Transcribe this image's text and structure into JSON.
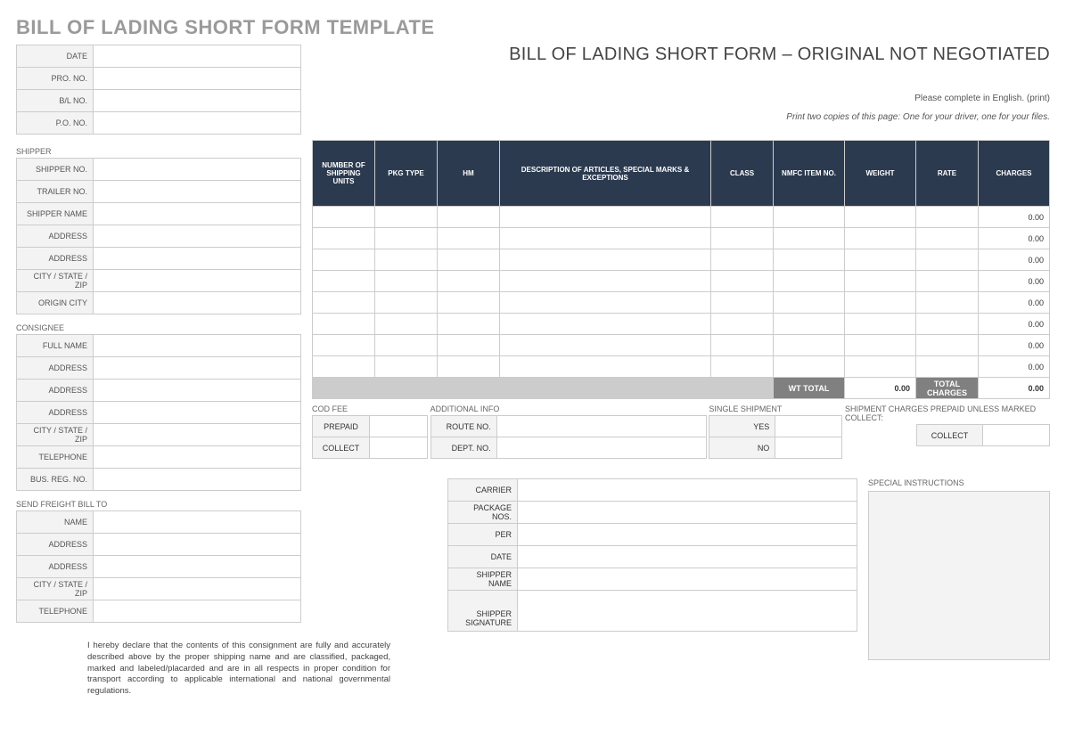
{
  "page_title": "BILL OF LADING SHORT FORM TEMPLATE",
  "form_title": "BILL OF LADING SHORT FORM – ORIGINAL NOT NEGOTIATED",
  "instructions_1": "Please complete in English. (print)",
  "instructions_2": "Print two copies of this page: One for your driver, one for your files.",
  "header_fields": {
    "date_label": "DATE",
    "date": "",
    "pro_no_label": "PRO. NO.",
    "pro_no": "",
    "bl_no_label": "B/L NO.",
    "bl_no": "",
    "po_no_label": "P.O. NO.",
    "po_no": ""
  },
  "shipper": {
    "section": "SHIPPER",
    "shipper_no_label": "SHIPPER NO.",
    "shipper_no": "",
    "trailer_no_label": "TRAILER NO.",
    "trailer_no": "",
    "name_label": "SHIPPER NAME",
    "name": "",
    "address1_label": "ADDRESS",
    "address1": "",
    "address2_label": "ADDRESS",
    "address2": "",
    "csz_label": "CITY / STATE / ZIP",
    "csz": "",
    "origin_label": "ORIGIN CITY",
    "origin": ""
  },
  "consignee": {
    "section": "CONSIGNEE",
    "name_label": "FULL NAME",
    "name": "",
    "address1_label": "ADDRESS",
    "address1": "",
    "address2_label": "ADDRESS",
    "address2": "",
    "address3_label": "ADDRESS",
    "address3": "",
    "csz_label": "CITY / STATE / ZIP",
    "csz": "",
    "phone_label": "TELEPHONE",
    "phone": "",
    "busreg_label": "BUS. REG. NO.",
    "busreg": ""
  },
  "freight_bill": {
    "section": "SEND FREIGHT BILL TO",
    "name_label": "NAME",
    "name": "",
    "address1_label": "ADDRESS",
    "address1": "",
    "address2_label": "ADDRESS",
    "address2": "",
    "csz_label": "CITY / STATE / ZIP",
    "csz": "",
    "phone_label": "TELEPHONE",
    "phone": ""
  },
  "items": {
    "headers": {
      "units": "NUMBER OF SHIPPING UNITS",
      "pkg": "PKG TYPE",
      "hm": "HM",
      "desc": "DESCRIPTION OF ARTICLES, SPECIAL MARKS & EXCEPTIONS",
      "class": "CLASS",
      "nmfc": "NMFC ITEM NO.",
      "weight": "WEIGHT",
      "rate": "RATE",
      "charges": "CHARGES"
    },
    "row_charge": "0.00",
    "wt_total_label": "WT TOTAL",
    "wt_total": "0.00",
    "total_charges_label": "TOTAL CHARGES",
    "total_charges": "0.00"
  },
  "cod": {
    "section": "COD FEE",
    "prepaid_label": "PREPAID",
    "prepaid": "",
    "collect_label": "COLLECT",
    "collect": ""
  },
  "addl": {
    "section": "ADDITIONAL INFO",
    "route_label": "ROUTE NO.",
    "route": "",
    "dept_label": "DEPT. NO.",
    "dept": ""
  },
  "single_shipment": {
    "section": "SINGLE SHIPMENT",
    "yes_label": "YES",
    "yes": "",
    "no_label": "NO",
    "no": ""
  },
  "ship_charges": {
    "section": "SHIPMENT CHARGES PREPAID UNLESS MARKED COLLECT:",
    "collect_label": "COLLECT",
    "collect": ""
  },
  "carrier": {
    "carrier_label": "CARRIER",
    "carrier": "",
    "pkgnos_label": "PACKAGE NOS.",
    "pkgnos": "",
    "per_label": "PER",
    "per": "",
    "date_label": "DATE",
    "date": "",
    "shipper_name_label": "SHIPPER NAME",
    "shipper_name": "",
    "sig_label": "SHIPPER SIGNATURE",
    "sig": ""
  },
  "special_instructions_label": "SPECIAL INSTRUCTIONS",
  "declaration": "I hereby declare that the contents of this consignment are fully and accurately described above by the proper shipping name and are classified, packaged, marked and labeled/placarded and are in all respects in proper condition for transport according to applicable international and national governmental regulations."
}
